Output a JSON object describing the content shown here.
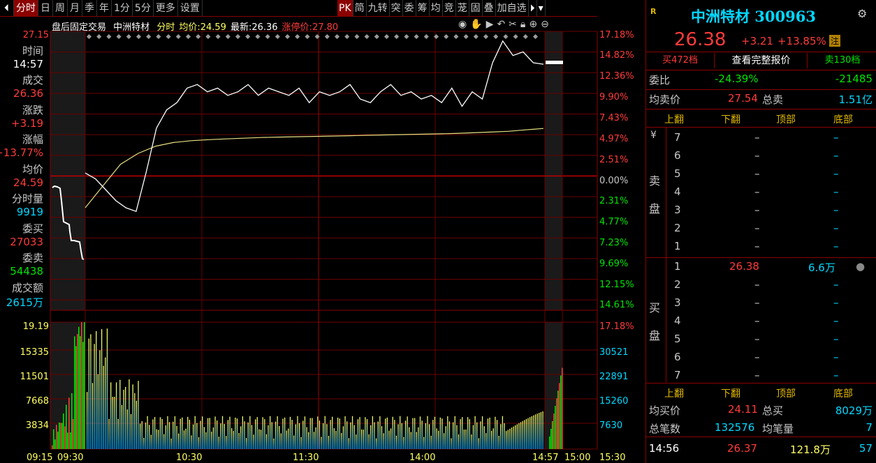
{
  "toolbar": {
    "left_items": [
      "分时",
      "日",
      "周",
      "月",
      "季",
      "年",
      "1分",
      "5分",
      "更多",
      "设置"
    ],
    "active_index": 0,
    "right_items": [
      "PK",
      "简",
      "九转",
      "突",
      "委",
      "筹",
      "均",
      "竞",
      "茏",
      "固",
      "叠",
      "加自选"
    ]
  },
  "info": {
    "mode": "盘后固定交易",
    "name": "中洲特材",
    "period": "分时",
    "avg_label": "均价:",
    "avg_value": "24.59",
    "last_label": "最新:",
    "last_value": "26.36",
    "limit_label": "涨停价:",
    "limit_value": "27.80"
  },
  "left_panel": {
    "time_label": "时间",
    "time": "14:57",
    "deal_label": "成交",
    "deal": "26.36",
    "chg_label": "涨跌",
    "chg": "+3.19",
    "pct_label": "涨幅",
    "pct": "+13.77%",
    "avg_label": "均价",
    "avg": "24.59",
    "vol_label": "分时量",
    "vol": "9919",
    "bid_label": "委买",
    "bid": "27033",
    "ask_label": "委卖",
    "ask": "54438",
    "amount_label": "成交额",
    "amount": "2615万"
  },
  "axes": {
    "price_top": "27.15",
    "pct_right": [
      "17.18%",
      "14.82%",
      "12.36%",
      "9.90%",
      "7.43%",
      "4.97%",
      "2.51%",
      "0.00%",
      "2.31%",
      "4.77%",
      "7.23%",
      "9.69%",
      "12.15%",
      "14.61%"
    ],
    "vol_top_left": "19.19",
    "vol_top_right": "17.18%",
    "vol_left": [
      "15335",
      "11501",
      "7668",
      "3834"
    ],
    "vol_right": [
      "30521",
      "22891",
      "15260",
      "7630"
    ],
    "time_ticks": [
      "09:15",
      "09:30",
      "10:30",
      "11:30",
      "14:00",
      "14:57",
      "15:00",
      "15:30"
    ]
  },
  "chart_data": {
    "type": "line",
    "title": "",
    "series": [
      {
        "values": [
          23.36,
          23.2,
          22.9,
          22.6,
          22.4,
          22.3,
          23.4,
          24.6,
          25.1,
          25.3,
          25.7,
          25.8,
          25.6,
          25.7,
          25.5,
          25.6,
          25.8,
          25.5,
          25.7,
          25.6,
          25.5,
          25.7,
          25.3,
          25.6,
          25.5,
          25.6,
          25.8,
          25.4,
          25.3,
          25.6,
          25.8,
          25.5,
          25.6,
          25.4,
          25.5,
          25.3,
          25.7,
          25.2,
          25.6,
          25.4,
          26.4,
          27.0,
          26.6,
          26.7,
          26.4,
          26.36
        ]
      },
      {
        "values": [
          22.4,
          23.0,
          23.6,
          23.9,
          24.1,
          24.2,
          24.25,
          24.28,
          24.3,
          24.32,
          24.34,
          24.35,
          24.36,
          24.37,
          24.38,
          24.39,
          24.4,
          24.41,
          24.42,
          24.43,
          24.44,
          24.45,
          24.47,
          24.49,
          24.51,
          24.55,
          24.59
        ]
      }
    ]
  },
  "right_panel": {
    "badge": "R",
    "stock": "中洲特材 300963",
    "price": "26.38",
    "chg": "+3.21",
    "pct": "+13.85%",
    "tag": "注",
    "buy_btn": "买472档",
    "full_quote": "查看完整报价",
    "sell_btn": "卖130档",
    "webi_label": "委比",
    "webi_pct": "-24.39%",
    "webi_diff": "-21485",
    "avg_sell_label": "均卖价",
    "avg_sell": "27.54",
    "total_sell_label": "总卖",
    "total_sell": "1.51亿",
    "flip_headers": [
      "上翻",
      "下翻",
      "顶部",
      "底部"
    ],
    "sell_side_label": [
      "¥",
      "卖",
      "盘"
    ],
    "sell_levels": [
      {
        "n": "7",
        "p": "–",
        "v": "–"
      },
      {
        "n": "6",
        "p": "–",
        "v": "–"
      },
      {
        "n": "5",
        "p": "–",
        "v": "–"
      },
      {
        "n": "4",
        "p": "–",
        "v": "–"
      },
      {
        "n": "3",
        "p": "–",
        "v": "–"
      },
      {
        "n": "2",
        "p": "–",
        "v": "–"
      },
      {
        "n": "1",
        "p": "–",
        "v": "–"
      }
    ],
    "buy_side_label": [
      "买",
      "盘"
    ],
    "buy_levels": [
      {
        "n": "1",
        "p": "26.38",
        "v": "6.6万"
      },
      {
        "n": "2",
        "p": "–",
        "v": "–"
      },
      {
        "n": "3",
        "p": "–",
        "v": "–"
      },
      {
        "n": "4",
        "p": "–",
        "v": "–"
      },
      {
        "n": "5",
        "p": "–",
        "v": "–"
      },
      {
        "n": "6",
        "p": "–",
        "v": "–"
      },
      {
        "n": "7",
        "p": "–",
        "v": "–"
      }
    ],
    "avg_buy_label": "均买价",
    "avg_buy": "24.11",
    "total_buy_label": "总买",
    "total_buy": "8029万",
    "deals_label": "总笔数",
    "deals": "132576",
    "avg_vol_label": "均笔量",
    "avg_vol": "7",
    "tick_time": "14:56",
    "tick_price": "26.37",
    "tick_amount": "121.8万",
    "tick_count": "57"
  }
}
